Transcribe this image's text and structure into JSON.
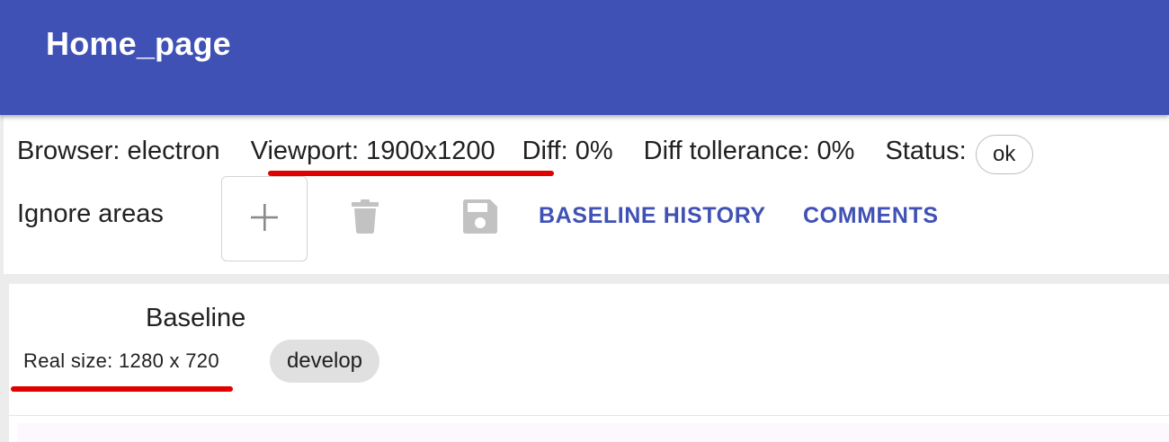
{
  "colors": {
    "accent": "#4051b5",
    "annotation_mark": "#e00000",
    "chip_background": "#e0e0e0"
  },
  "appbar": {
    "title": "Home_page"
  },
  "info": {
    "browser": "Browser: electron",
    "viewport": "Viewport: 1900x1200",
    "diff": "Diff: 0%",
    "diff_tolerance": "Diff tollerance: 0%",
    "status_label": "Status:",
    "status_value": "ok"
  },
  "ignore_areas": {
    "label": "Ignore areas",
    "add_icon": "plus-icon",
    "delete_icon": "trash-icon",
    "save_icon": "floppy-disk-icon"
  },
  "actions": {
    "baseline_history": "BASELINE HISTORY",
    "comments": "COMMENTS"
  },
  "baseline": {
    "title": "Baseline",
    "real_size": "Real size: 1280 x 720",
    "branch": "develop"
  }
}
